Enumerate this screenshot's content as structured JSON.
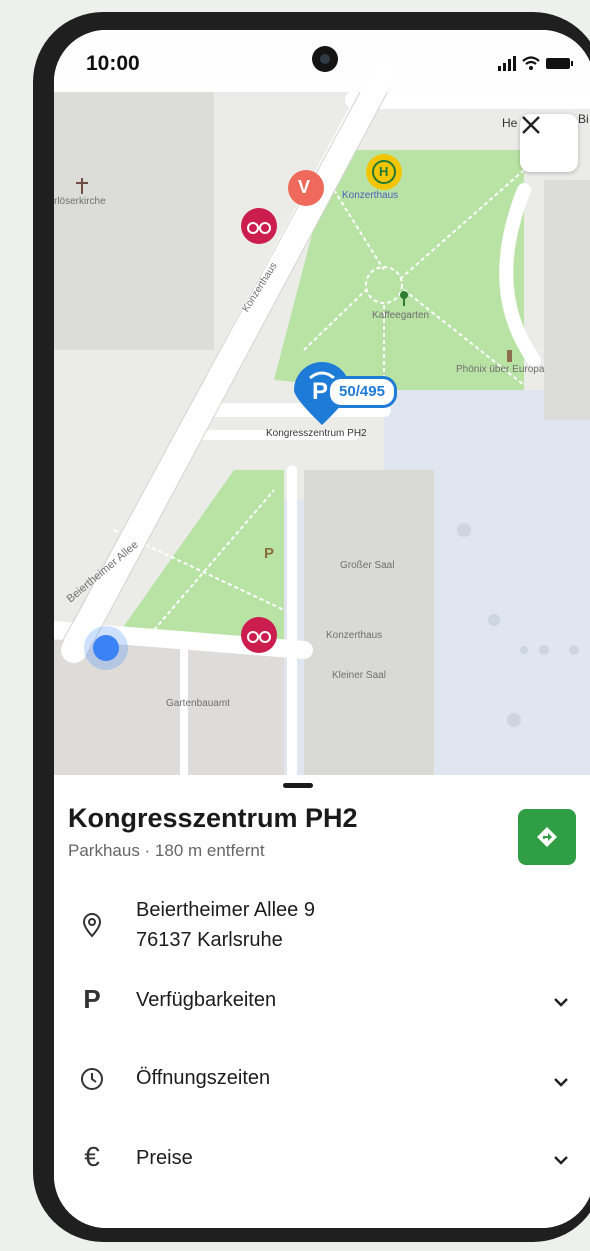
{
  "status_bar": {
    "time": "10:00"
  },
  "map": {
    "labels": {
      "church": "rlöserkirche",
      "street_konzerthaus": "Konzerthaus",
      "bus_stop": "Konzerthaus",
      "kaffeegarten": "Kaffeegarten",
      "phoenix": "Phönix über Europa",
      "parking_pin": "Kongresszentrum PH2",
      "grosser_saal": "Großer Saal",
      "konzerthaus_building": "Konzerthaus",
      "kleiner_saal": "Kleiner Saal",
      "gartenbauamt": "Gartenbauamt",
      "beiertheimer": "Beiertheimer Allee",
      "he_street": "He",
      "bi_street": "Bi",
      "parking_letter": "P",
      "poi_letter_v": "V",
      "bus_letter": "H"
    },
    "parking_availability": "50/495",
    "pin_letter": "P",
    "colors": {
      "park": "#b7e4a6",
      "street": "#ffffff",
      "water_plaza": "#dde7f2",
      "bike": "#cc1e4e",
      "pin": "#1f7bd8",
      "bus": "#f2c500"
    }
  },
  "sheet": {
    "title": "Kongresszentrum PH2",
    "subtitle": "Parkhaus · 180 m entfernt",
    "address_line1": "Beiertheimer Allee 9",
    "address_line2": "76137 Karlsruhe",
    "sections": [
      {
        "label": "Verfügbarkeiten",
        "icon": "parking-icon"
      },
      {
        "label": "Öffnungszeiten",
        "icon": "clock-icon"
      },
      {
        "label": "Preise",
        "icon": "euro-icon"
      }
    ],
    "euro_symbol": "€",
    "parking_symbol": "P"
  }
}
